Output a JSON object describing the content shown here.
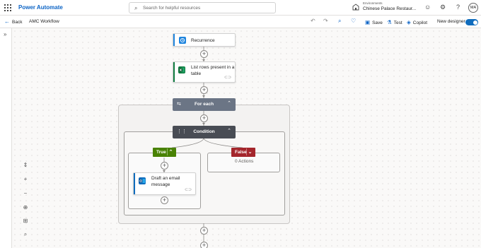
{
  "app": {
    "name": "Power Automate",
    "search_placeholder": "Search for helpful resources",
    "env_label": "Environments",
    "env_name": "Chinese Palace Restaur...",
    "avatar_initials": "MA"
  },
  "command_bar": {
    "back_label": "Back",
    "flow_name": "AMC Workflow",
    "save_label": "Save",
    "test_label": "Test",
    "copilot_label": "Copilot",
    "new_designer_label": "New designer",
    "new_designer_on": true
  },
  "flow": {
    "trigger": {
      "title": "Recurrence",
      "icon": "recurrence-icon"
    },
    "list_rows": {
      "title_line1": "List rows present in a",
      "title_line2": "table",
      "icon": "excel-icon"
    },
    "foreach": {
      "title": "For each",
      "icon": "loop-icon"
    },
    "condition": {
      "title": "Condition",
      "icon": "condition-icon"
    },
    "true_branch": {
      "label": "True"
    },
    "false_branch": {
      "label": "False",
      "empty_text": "0 Actions"
    },
    "draft_email": {
      "title_line1": "Draft an email",
      "title_line2": "message",
      "icon": "outlook-icon"
    }
  },
  "colors": {
    "brand": "#0b63c5",
    "true_green": "#498205",
    "false_red": "#a4262c",
    "foreach_gray": "#6b7585",
    "condition_dark": "#484c54",
    "excel_green": "#107c41",
    "recurrence_blue": "#1f85de"
  }
}
